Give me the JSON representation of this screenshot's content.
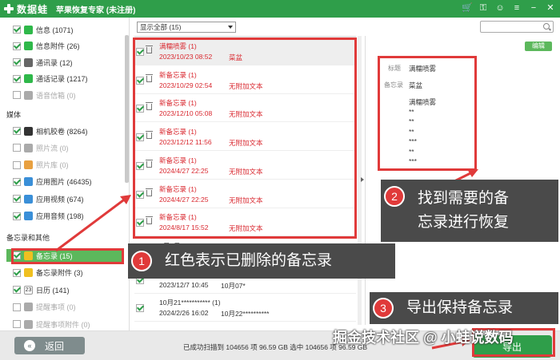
{
  "titlebar": {
    "logo_text": "数据蛙",
    "app_title": "苹果恢复专家 (未注册)",
    "icons": [
      "cart-icon",
      "key-icon",
      "chat-icon",
      "menu-icon",
      "minimize-icon",
      "close-icon"
    ],
    "icon_glyphs": [
      "🛒",
      "⚿",
      "☺",
      "≡",
      "−",
      "✕"
    ]
  },
  "sidebar": {
    "items_top": [
      {
        "label": "信息 (1071)",
        "checked": true,
        "icon": "message-icon",
        "color": "#2fb84a"
      },
      {
        "label": "信息附件 (26)",
        "checked": true,
        "icon": "message-attachment-icon",
        "color": "#2fb84a"
      },
      {
        "label": "通讯录 (12)",
        "checked": true,
        "icon": "contacts-icon",
        "color": "#666666"
      },
      {
        "label": "通话记录 (1217)",
        "checked": true,
        "icon": "phone-icon",
        "color": "#2fb84a"
      },
      {
        "label": "语音信箱 (0)",
        "checked": false,
        "icon": "voicemail-icon",
        "color": "#aaaaaa"
      }
    ],
    "media_header": "媒体",
    "items_media": [
      {
        "label": "相机胶卷 (8264)",
        "checked": true,
        "icon": "camera-icon",
        "color": "#333333"
      },
      {
        "label": "照片流 (0)",
        "checked": false,
        "icon": "photo-stream-icon",
        "color": "#aaaaaa"
      },
      {
        "label": "照片库 (0)",
        "checked": false,
        "icon": "photo-library-icon",
        "color": "#e8a040"
      },
      {
        "label": "应用图片 (46435)",
        "checked": true,
        "icon": "app-photo-icon",
        "color": "#3a8fd8"
      },
      {
        "label": "应用视频 (674)",
        "checked": true,
        "icon": "app-video-icon",
        "color": "#3a8fd8"
      },
      {
        "label": "应用音频 (198)",
        "checked": true,
        "icon": "app-audio-icon",
        "color": "#3a8fd8"
      }
    ],
    "memo_header": "备忘录和其他",
    "items_memo": [
      {
        "label": "备忘录 (15)",
        "checked": true,
        "icon": "notes-icon",
        "color": "#f0c020",
        "selected": true
      },
      {
        "label": "备忘录附件 (3)",
        "checked": true,
        "icon": "notes-attachment-icon",
        "color": "#f0c020"
      },
      {
        "label": "日历 (141)",
        "checked": true,
        "icon": "calendar-icon",
        "color": "#ffffff"
      },
      {
        "label": "提醒事项 (0)",
        "checked": false,
        "icon": "reminder-icon",
        "color": "#aaaaaa"
      },
      {
        "label": "提醒事项附件 (0)",
        "checked": false,
        "icon": "reminder-attachment-icon",
        "color": "#aaaaaa"
      }
    ],
    "calendar_day": "23"
  },
  "filter": {
    "label": "显示全部 (15)"
  },
  "list": {
    "rows": [
      {
        "t1": "满糯喷雾 (1)",
        "t2": "2023/10/23 08:52",
        "t3": "菜盆",
        "deleted": true
      },
      {
        "t1": "新备忘录 (1)",
        "t2": "2023/10/29 02:54",
        "t3": "无附加文本",
        "deleted": true
      },
      {
        "t1": "新备忘录 (1)",
        "t2": "2023/12/10 05:08",
        "t3": "无附加文本",
        "deleted": true
      },
      {
        "t1": "新备忘录 (1)",
        "t2": "2023/12/12 11:56",
        "t3": "无附加文本",
        "deleted": true
      },
      {
        "t1": "新备忘录 (1)",
        "t2": "2024/4/27 22:25",
        "t3": "无附加文本",
        "deleted": true
      },
      {
        "t1": "新备忘录 (1)",
        "t2": "2024/4/27 22:25",
        "t3": "无附加文本",
        "deleted": true
      },
      {
        "t1": "新备忘录 (1)",
        "t2": "2024/8/17 15:52",
        "t3": "无附加文本",
        "deleted": true
      },
      {
        "t1": "1月8日******** (1)",
        "t2": "",
        "t3": "",
        "deleted": false
      },
      {
        "t1": "11月7* (1)",
        "t2": "2023/12/7 10:45",
        "t3": "10月07*",
        "deleted": false
      },
      {
        "t1": "10月21*********** (1)",
        "t2": "2024/2/26 16:02",
        "t3": "10月22**********",
        "deleted": false
      }
    ]
  },
  "detail": {
    "edit_label": "编辑",
    "title_label": "标题",
    "title_value": "满糯喷雾",
    "memo_label": "备忘录",
    "memo_value": "菜盆",
    "body_lines": [
      "满糯喷雾",
      "**",
      "**",
      "**",
      "***",
      "**",
      "***"
    ],
    "extra_lines": [
      "***",
      "**"
    ]
  },
  "bottom": {
    "back_label": "返回",
    "status_text": "已成功扫描到 104656 项 96.59 GB  选中 104656 项 96.59 GB",
    "export_label": "导出"
  },
  "annotations": {
    "callout1_num": "1",
    "callout1_text": "红色表示已删除的备忘录",
    "callout2_num": "2",
    "callout2_text_line1": "找到需要的备",
    "callout2_text_line2": "忘录进行恢复",
    "callout3_num": "3",
    "callout3_text": "导出保持备忘录",
    "watermark": "掘金技术社区 @ 小蛙说数码",
    "red_color": "#e03a3a"
  }
}
